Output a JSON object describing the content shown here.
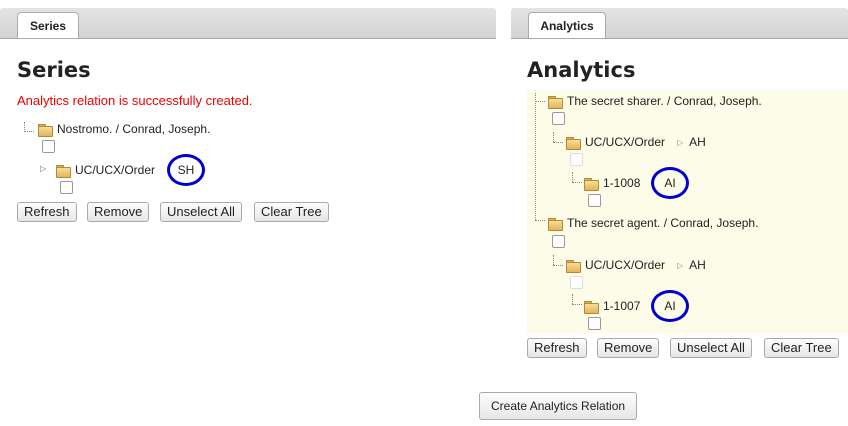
{
  "left": {
    "tab_label": "Series",
    "heading": "Series",
    "message": "Analytics relation is successfully created.",
    "tree": {
      "root_label": "Nostromo. / Conrad, Joseph.",
      "child_label": "UC/UCX/Order",
      "child_badge": "SH"
    },
    "buttons": {
      "refresh": "Refresh",
      "remove": "Remove",
      "unselect_all": "Unselect All",
      "clear_tree": "Clear Tree"
    }
  },
  "right": {
    "tab_label": "Analytics",
    "heading": "Analytics",
    "tree": [
      {
        "root_label": "The secret sharer. / Conrad, Joseph.",
        "child_label": "UC/UCX/Order",
        "child_tag": "AH",
        "leaf_label": "1-1008",
        "leaf_badge": "AI"
      },
      {
        "root_label": "The secret agent. / Conrad, Joseph.",
        "child_label": "UC/UCX/Order",
        "child_tag": "AH",
        "leaf_label": "1-1007",
        "leaf_badge": "AI"
      }
    ],
    "buttons": {
      "refresh": "Refresh",
      "remove": "Remove",
      "unselect_all": "Unselect All",
      "clear_tree": "Clear Tree"
    }
  },
  "create_button": "Create Analytics Relation",
  "colors": {
    "success": "#e00000",
    "annotation_circle": "#0000d0",
    "panel_bg": "#fcfce8"
  }
}
